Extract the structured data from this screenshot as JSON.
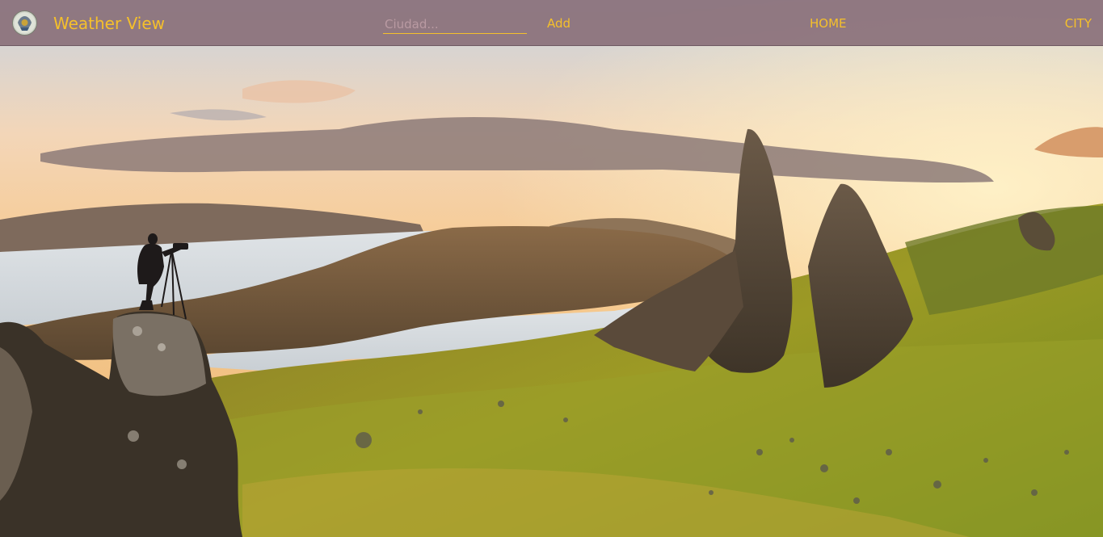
{
  "header": {
    "brand": "Weather View",
    "search": {
      "placeholder": "Ciudad...",
      "value": ""
    },
    "add_label": "Add",
    "nav": [
      {
        "label": "HOME"
      },
      {
        "label": "CITY"
      }
    ]
  },
  "hero": {
    "scene": "mountain-landscape-sunset-photographer"
  },
  "colors": {
    "accent": "#f5c02b",
    "navbar": "#8a707a"
  }
}
